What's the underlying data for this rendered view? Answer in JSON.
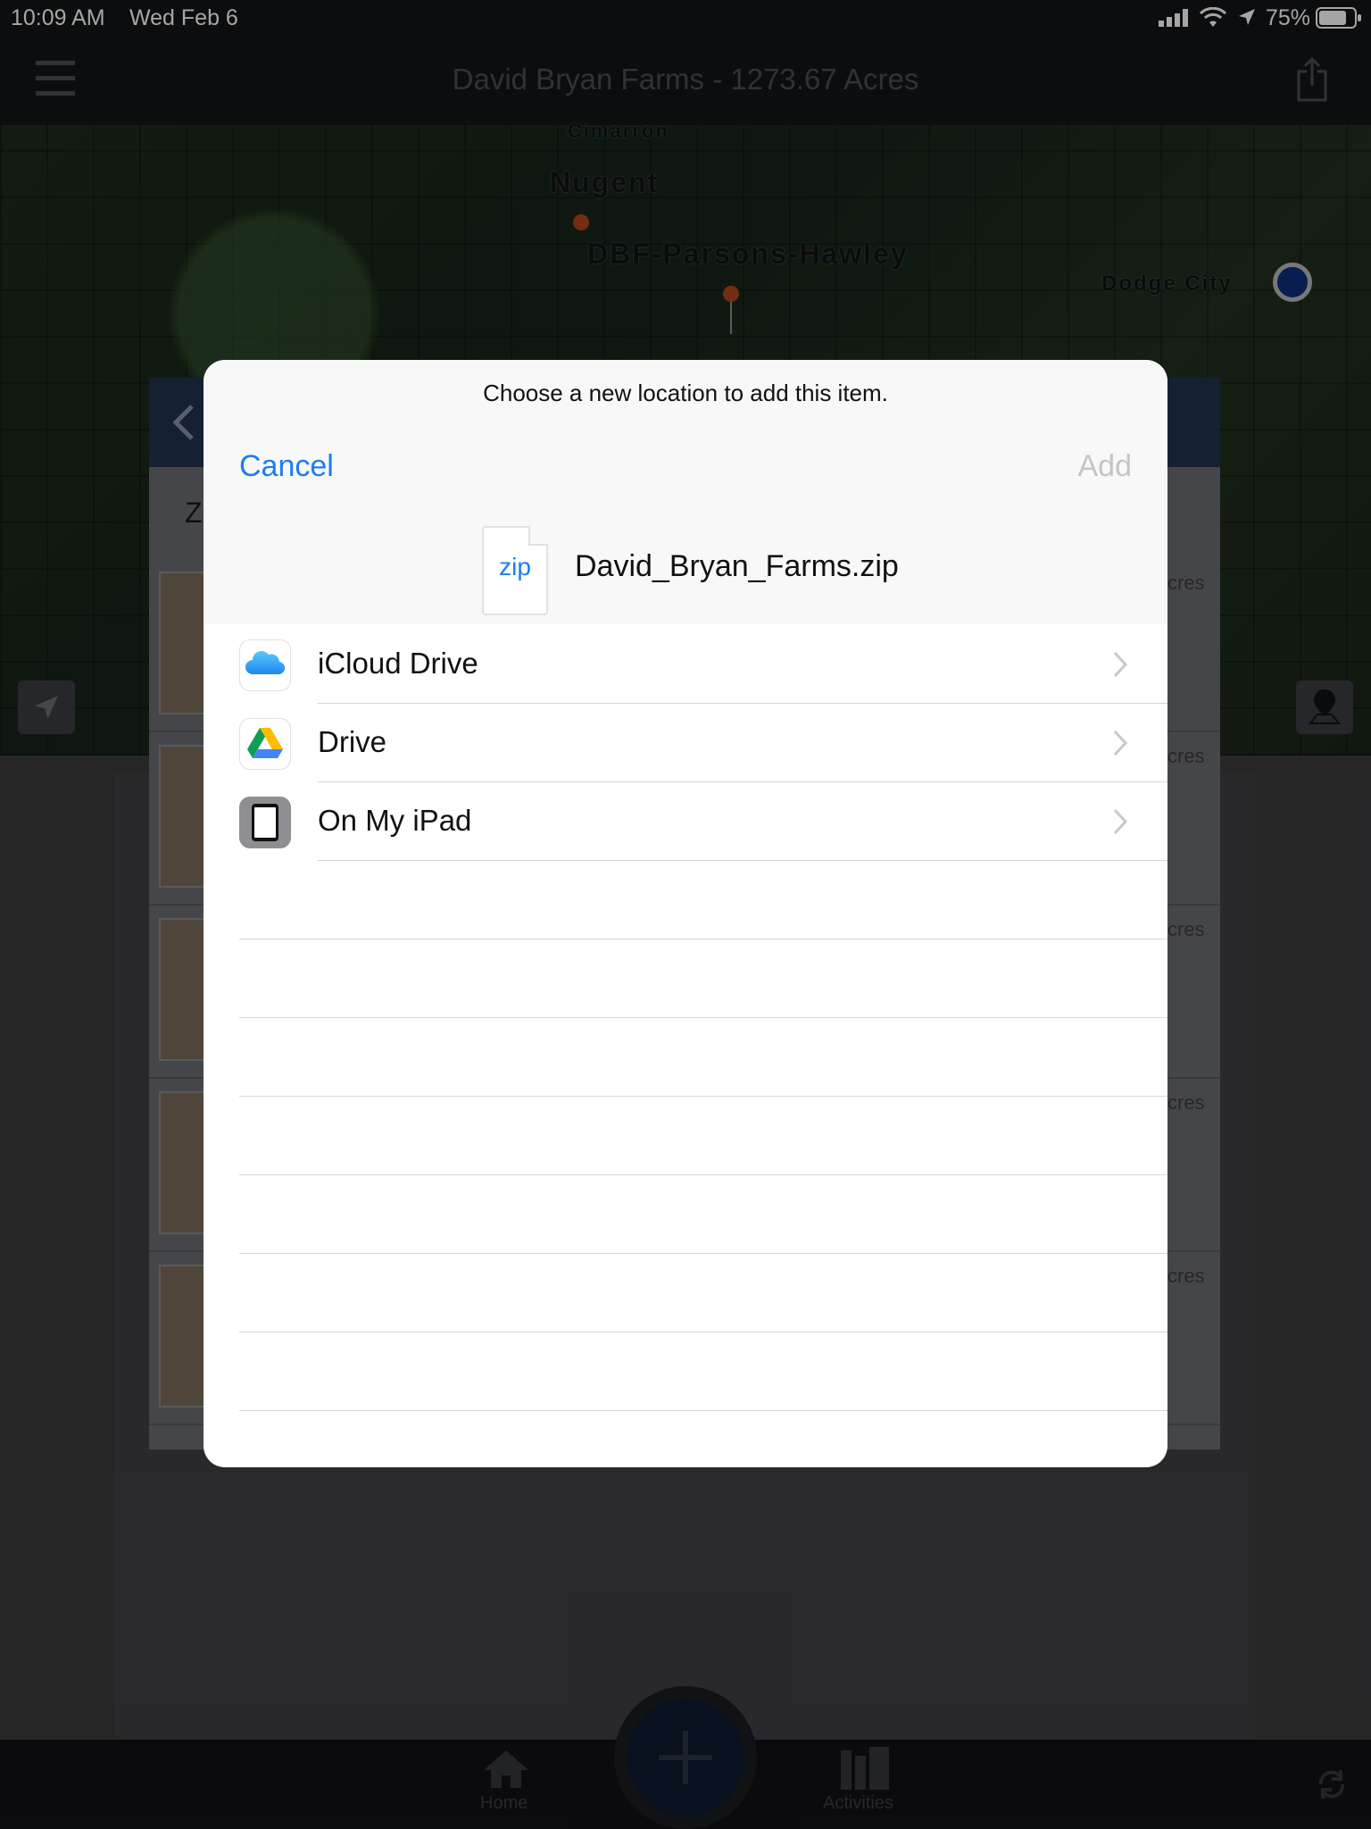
{
  "status_bar": {
    "time": "10:09 AM",
    "date": "Wed Feb 6",
    "battery": "75%"
  },
  "app": {
    "title": "David Bryan Farms - 1273.67 Acres"
  },
  "map": {
    "labels": [
      "Cimarron",
      "Nugent",
      "DBF-Parsons-Hawley",
      "Dodge City"
    ]
  },
  "background_list": {
    "header_letter": "Z",
    "row_suffix": "cres"
  },
  "tab_bar": {
    "home_label": "Home",
    "activities_label": "Activities"
  },
  "modal": {
    "prompt": "Choose a new location to add this item.",
    "cancel_label": "Cancel",
    "add_label": "Add",
    "file_ext": "zip",
    "file_name": "David_Bryan_Farms.zip",
    "locations": [
      {
        "label": "iCloud Drive",
        "icon": "icloud-icon"
      },
      {
        "label": "Drive",
        "icon": "google-drive-icon"
      },
      {
        "label": "On My iPad",
        "icon": "ipad-icon"
      }
    ]
  },
  "colors": {
    "accent": "#1f7cf0",
    "disabled": "#c5c5c7"
  }
}
